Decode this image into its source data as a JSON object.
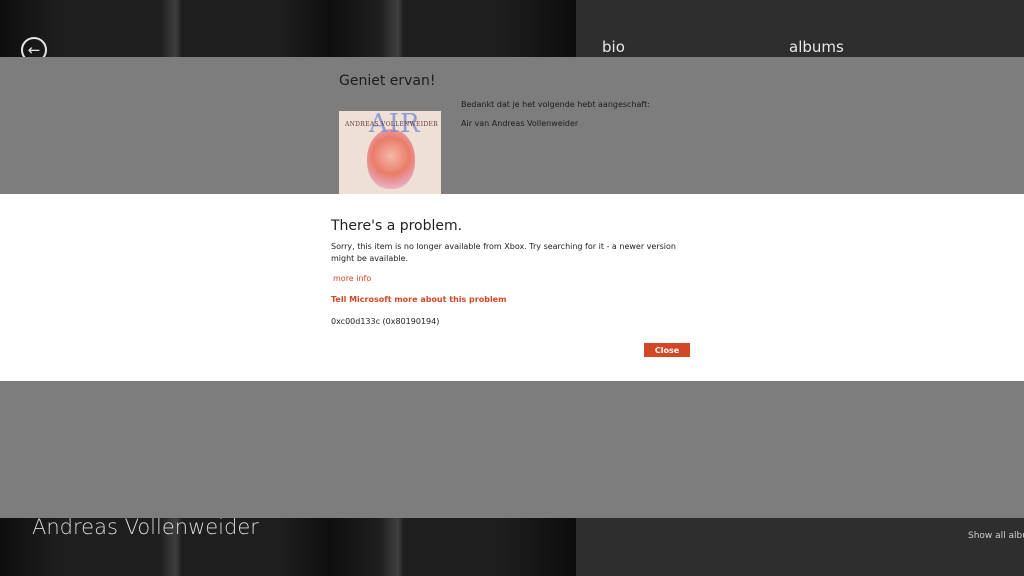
{
  "app": {
    "nav_tabs": [
      {
        "label": "bio"
      },
      {
        "label": "albums"
      }
    ],
    "artist_name": "Andreas Vollenweider",
    "show_all_label": "Show all album"
  },
  "purchase": {
    "title": "Geniet ervan!",
    "thanks": "Bedankt dat je het volgende hebt aangeschaft:",
    "item": "Air van Andreas Vollenweider",
    "album_art_text": "AIR",
    "album_art_artist": "ANDREAS VOLLENWEIDER"
  },
  "dialog": {
    "title": "There's a problem.",
    "message": "Sorry, this item is no longer available from Xbox. Try searching for it - a newer version might be available.",
    "more_info_link": "more info",
    "tell_microsoft_link": "Tell Microsoft more about this problem",
    "error_code": "0xc00d133c (0x80190194)",
    "close_button": "Close"
  },
  "colors": {
    "accent": "#d24726",
    "overlay": "#7d7d7d",
    "dialog_bg": "#ffffff"
  },
  "icons": {
    "back": "back-arrow-icon"
  }
}
